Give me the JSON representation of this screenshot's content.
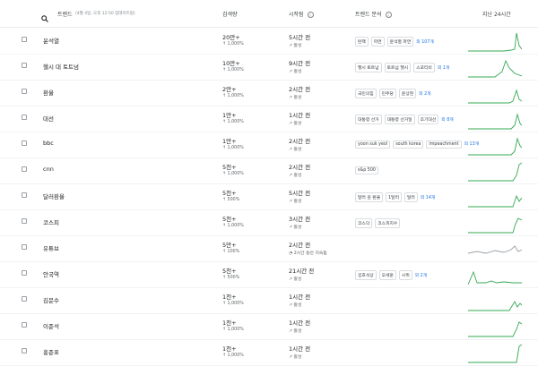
{
  "header": {
    "trend_label": "트렌드",
    "trend_sub": "(4월 4일, 오후 12:50 업데이트됨)",
    "volume_label": "검색량",
    "started_label": "시작됨",
    "breakdown_label": "트렌드 분석",
    "past24_label": "지난 24시간"
  },
  "rows": [
    {
      "name": "윤석열",
      "volume": "20만+",
      "pct": "↑ 1,000%",
      "time": "5시간 전",
      "status": "↗ 활성",
      "chips": [
        "탄핵",
        "파면",
        "윤석열 파면"
      ],
      "more": "외 107개",
      "color": "#34a853"
    },
    {
      "name": "헬시 대 토트넘",
      "volume": "10만+",
      "pct": "↑ 1,000%",
      "time": "9시간 전",
      "status": "↗ 활성",
      "chips": [
        "헬시 토트넘",
        "토트넘 헬시",
        "스포티비"
      ],
      "more": "외 1개",
      "color": "#34a853"
    },
    {
      "name": "환율",
      "volume": "2만+",
      "pct": "↑ 1,000%",
      "time": "2시간 전",
      "status": "↗ 활성",
      "chips": [
        "국민의힘",
        "민주당",
        "윤상현"
      ],
      "more": "외 2개",
      "color": "#34a853"
    },
    {
      "name": "대선",
      "volume": "1만+",
      "pct": "↑ 1,000%",
      "time": "1시간 전",
      "status": "↗ 활성",
      "chips": [
        "대통령 선거",
        "대통령 선거일",
        "조기대선"
      ],
      "more": "외 8개",
      "color": "#34a853"
    },
    {
      "name": "bbc",
      "volume": "1만+",
      "pct": "↑ 1,000%",
      "time": "2시간 전",
      "status": "↗ 활성",
      "chips": [
        "yoon suk yeol",
        "south korea",
        "impeachment"
      ],
      "more": "외 13개",
      "color": "#34a853"
    },
    {
      "name": "cnn",
      "volume": "5천+",
      "pct": "↑ 1,000%",
      "time": "2시간 전",
      "status": "↗ 활성",
      "chips": [
        "s&p 500"
      ],
      "more": "",
      "color": "#34a853"
    },
    {
      "name": "달러환율",
      "volume": "5천+",
      "pct": "↑ 500%",
      "time": "5시간 전",
      "status": "↗ 활성",
      "chips": [
        "달러 원 환율",
        "1달러",
        "달러"
      ],
      "more": "외 14개",
      "color": "#34a853"
    },
    {
      "name": "코스피",
      "volume": "5천+",
      "pct": "↑ 1,000%",
      "time": "3시간 전",
      "status": "↗ 활성",
      "chips": [
        "코스닥",
        "코스피지수"
      ],
      "more": "",
      "color": "#34a853"
    },
    {
      "name": "유튜브",
      "volume": "5만+",
      "pct": "↑ 100%",
      "time": "2시간 전",
      "status": "◔ 2시간 동안 지속됨",
      "chips": [],
      "more": "",
      "color": "#9aa0a6"
    },
    {
      "name": "안국역",
      "volume": "5천+",
      "pct": "↑ 500%",
      "time": "21시간 전",
      "status": "↗ 활성",
      "chips": [
        "김호석상",
        "오세훈",
        "시위"
      ],
      "more": "외 2개",
      "color": "#34a853"
    },
    {
      "name": "김문수",
      "volume": "1천+",
      "pct": "↑ 1,000%",
      "time": "1시간 전",
      "status": "↗ 활성",
      "chips": [],
      "more": "",
      "color": "#34a853"
    },
    {
      "name": "이준석",
      "volume": "1천+",
      "pct": "↑ 1,000%",
      "time": "1시간 전",
      "status": "↗ 활성",
      "chips": [],
      "more": "",
      "color": "#34a853"
    },
    {
      "name": "홍준표",
      "volume": "1천+",
      "pct": "↑ 1,000%",
      "time": "1시간 전",
      "status": "↗ 활성",
      "chips": [],
      "more": "",
      "color": "#34a853"
    }
  ]
}
